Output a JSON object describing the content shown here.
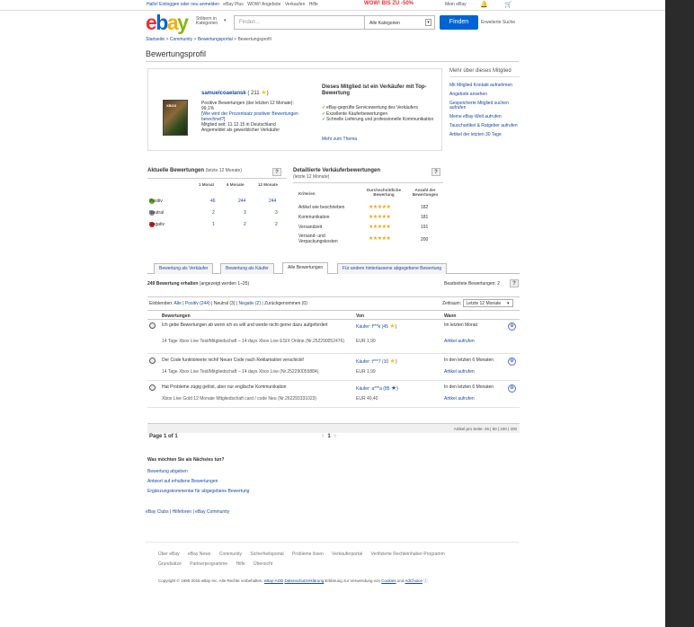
{
  "topbar": {
    "greeting": "Hallo! Einloggen oder neu anmelden",
    "links": [
      "eBay Plus",
      "WOW! Angebote",
      "Verkaufen",
      "Hilfe"
    ],
    "promo": "WOW! BIS ZU -50%",
    "my_ebay": "Mein eBay"
  },
  "header": {
    "logo": {
      "e": "e",
      "b": "b",
      "a": "a",
      "y": "y"
    },
    "category_button": "Stöbern in Kategorien",
    "search_placeholder": "Finden...",
    "category_select": "Alle Kategorien",
    "find_button": "Finden",
    "advanced_search": "Erweiterte Suche"
  },
  "breadcrumb": [
    "Startseite",
    "Community",
    "Bewertungsportal",
    "Bewertungsprofil"
  ],
  "page_title": "Bewertungsprofil",
  "profile": {
    "username": "samuelcoaelansk",
    "score": "( 211",
    "score_close": ")",
    "positive": "Positive Bewertungen (der letzten 12 Monate):",
    "positive_pct": "99,1%",
    "why_link": "[Wie wird der Prozentsatz positiver Bewertungen berechnet?]",
    "member_since": "Mitglied seit: 11.12.15 in Deutschland",
    "registered": "Angemeldet als gewerblicher Verkäufer",
    "avatar_label": "XBOX",
    "top_seller": "Dieses Mitglied ist ein Verkäufer mit Top-Bewertung",
    "features": [
      "eBay-geprüfte Servicewertung des Verkäufers",
      "Exzellente Käuferbewertungen",
      "Schnelle Lieferung und professionelle Kommunikation"
    ],
    "more_link": "Mehr zum Thema"
  },
  "sidebar": {
    "heading": "Mehr über dieses Mitglied",
    "links": [
      "Mit Mitglied Kontakt aufnehmen",
      "Angebote ansehen",
      "Gespeicherte Mitglied suchen aufrufen",
      "Meine eBay-Welt aufrufen",
      "Tauschartikel & Ratgeber aufrufen",
      "Artikel der letzten 30 Tage"
    ]
  },
  "recent_ratings": {
    "title": "Aktuelle Bewertungen",
    "subtitle": "(letzte 12 Monate)",
    "columns": [
      "1 Monat",
      "6 Monate",
      "12 Monate"
    ],
    "rows": [
      {
        "label": "Positiv",
        "values": [
          "46",
          "244",
          "244"
        ]
      },
      {
        "label": "Neutral",
        "values": [
          "2",
          "3",
          "3"
        ]
      },
      {
        "label": "Negativ",
        "values": [
          "1",
          "2",
          "2"
        ]
      }
    ]
  },
  "detailed_ratings": {
    "title": "Detaillierte Verkäuferbewertungen",
    "subtitle": "(letzte 12 Monate)",
    "columns": [
      "Kriterien",
      "Durchschnittliche Bewertung",
      "Anzahl der Bewertungen"
    ],
    "rows": [
      {
        "label": "Artikel wie beschrieben",
        "stars": "★★★★★",
        "count": "182"
      },
      {
        "label": "Kommunikation",
        "stars": "★★★★★",
        "count": "181"
      },
      {
        "label": "Versandzeit",
        "stars": "★★★★★",
        "count": "191"
      },
      {
        "label": "Versand- und Verpackungskosten",
        "stars": "★★★★★",
        "count": "200"
      }
    ]
  },
  "tabs": [
    "Bewertung als Verkäufer",
    "Bewertung als Käufer",
    "Alle Bewertungen",
    "Für andere hinterlassene abgegebene Bewertung"
  ],
  "counts": {
    "received": "249 Bewertung erhalten",
    "shown": "(angezeigt werden 1–25)",
    "received_right": "Bearbeitete Bewertungen: 2"
  },
  "filter": {
    "label": "Einblenden:",
    "all": "Alle",
    "positive": "Positiv (244)",
    "neutral": "Neutral (3)",
    "negative": "Negativ (2)",
    "withdrawn": "Zurückgenommen (0)",
    "period_label": "Zeitraum:",
    "period_value": "Letzte 12 Monate"
  },
  "feedback_table": {
    "headers": [
      "Bewertungen",
      "Von",
      "Wann"
    ],
    "rows": [
      {
        "comment": "Ich gebe Bewertungen ab wenn ich es will und werde nicht gerne dazu aufgefordert",
        "item": "14 Tage Xbox Live Test/Mitgliedschaft – 14 days Xbox Live ESIX Online (Nr.252290052476)",
        "buyer": "Käufer: f***k (45",
        "buyer_close": ")",
        "price": "EUR 1,99",
        "when": "Im letzten Monat",
        "view": "Artikel aufrufen"
      },
      {
        "comment": "Der Code funktionierte nicht! Neuer Code nach Reklamation verschickt!",
        "item": "14 Tage Xbox Live Test/Mitgliedschaft – 14 days Xbox Live (Nr.252290055884)",
        "buyer": "Käufer: t***7 (10",
        "buyer_close": ")",
        "price": "EUR 1,99",
        "when": "In den letzten 6 Monaten",
        "view": "Artikel aufrufen"
      },
      {
        "comment": "Hat Probleme zügig gelöst, aber nur englische Kommunikation",
        "item": "Xbox Live Gold 12 Monate Mitgliedschaft card / code Neu (Nr.262293331023)",
        "buyer": "Käufer: a***a (85",
        "buyer_close": ")",
        "price": "EUR 40,40",
        "when": "In den letzten 6 Monaten",
        "view": "Artikel aufrufen"
      }
    ]
  },
  "pager": {
    "per_page": "Artikel pro Seite: 25 | 50 | 100 | 200",
    "page_label": "Page 1 of 1",
    "current": "1"
  },
  "what_to_do": {
    "title": "Was möchten Sie als Nächstes tun?",
    "links": [
      "Bewertung abgeben",
      "Antwort auf erhaltene Bewertungen",
      "Ergänzungskommentar für abgegebene Bewertung"
    ]
  },
  "community_links": [
    "eBay Clubs",
    "Hilfeforen",
    "eBay Community"
  ],
  "footer": {
    "row1": [
      "Über eBay",
      "eBay News",
      "Community",
      "Sicherheitsportal",
      "Probleme lösen",
      "Verkäuferportal",
      "Verifizierte Rechteinhaber-Programm"
    ],
    "row2": [
      "Grundsätze",
      "Partnerprogramme",
      "Hilfe",
      "Übersicht"
    ],
    "copyright": "Copyright © 1995-2016 eBay Inc. Alle Rechte vorbehalten.",
    "legal_links": [
      "eBay-AGB",
      "Datenschutzerklärung"
    ],
    "cookies_text": "Erklärung zur Verwendung von",
    "cookies": "Cookies",
    "und": "und",
    "adchoice": "AdChoice"
  }
}
